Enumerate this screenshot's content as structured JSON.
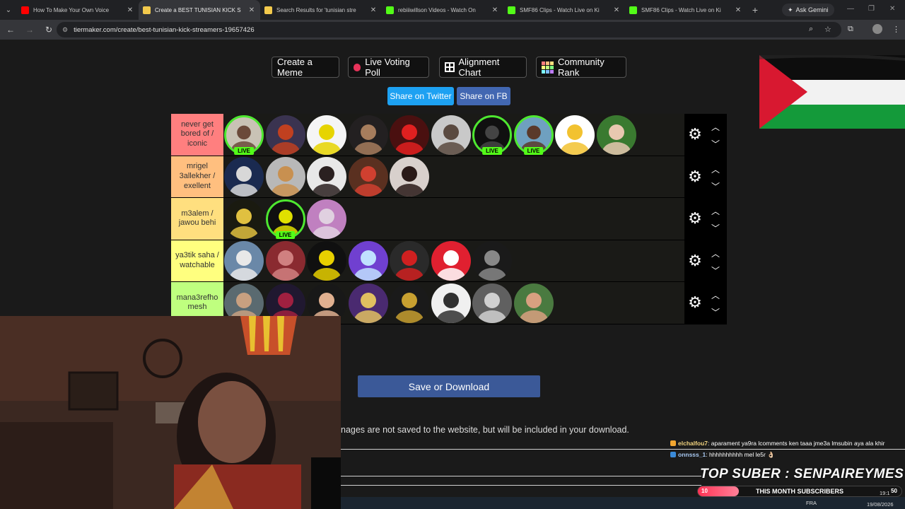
{
  "browser": {
    "tabs": [
      {
        "title": "How To Make Your Own Voice",
        "color": "#ff0000",
        "active": false
      },
      {
        "title": "Create a BEST TUNISIAN KICK S",
        "color": "#f2c94c",
        "active": true
      },
      {
        "title": "Search Results for 'tunisian stre",
        "color": "#f2c94c",
        "active": false
      },
      {
        "title": "rebiiiwillson Videos - Watch On",
        "color": "#53fc18",
        "active": false
      },
      {
        "title": "SMF86 Clips - Watch Live on Ki",
        "color": "#53fc18",
        "active": false
      },
      {
        "title": "SMF86 Clips - Watch Live on Ki",
        "color": "#53fc18",
        "active": false
      }
    ],
    "gemini_label": "Ask Gemini",
    "url": "tiermaker.com/create/best-tunisian-kick-streamers-19657426"
  },
  "top_buttons": {
    "create_meme": "Create a Meme",
    "live_poll": "Live Voting Poll",
    "alignment": "Alignment Chart",
    "community": "Community Rank"
  },
  "share": {
    "twitter": "Share on Twitter",
    "fb": "Share on FB"
  },
  "live_label": "LIVE",
  "tiers": [
    {
      "label": "never get bored of / iconic",
      "color": "#ff7f7f",
      "items": [
        {
          "bg": "#c9c2b5",
          "fg": "#6b4a3a",
          "live": true
        },
        {
          "bg": "#3a3350",
          "fg": "#c04020",
          "live": false
        },
        {
          "bg": "#f5f5f5",
          "fg": "#e6d400",
          "live": false
        },
        {
          "bg": "#232021",
          "fg": "#a67d5d",
          "live": false
        },
        {
          "bg": "#4a1010",
          "fg": "#e02020",
          "live": false
        },
        {
          "bg": "#c9c9c9",
          "fg": "#5a4a40",
          "live": false
        },
        {
          "bg": "#101010",
          "fg": "#444444",
          "live": true
        },
        {
          "bg": "#6fa0c0",
          "fg": "#5a3a2a",
          "live": true
        },
        {
          "bg": "#ffffff",
          "fg": "#f2c230",
          "live": false
        },
        {
          "bg": "#3a7a30",
          "fg": "#e8c8b0",
          "live": false
        }
      ]
    },
    {
      "label": "mrigel 3allekher / exellent",
      "color": "#ffbf7f",
      "items": [
        {
          "bg": "#1a2a50",
          "fg": "#d8d8d8",
          "live": false
        },
        {
          "bg": "#b8b8b8",
          "fg": "#c89050",
          "live": false
        },
        {
          "bg": "#e8e8e8",
          "fg": "#2a2020",
          "live": false
        },
        {
          "bg": "#5a3020",
          "fg": "#d04030",
          "live": false
        },
        {
          "bg": "#d8d0cc",
          "fg": "#2a1a18",
          "live": false
        }
      ]
    },
    {
      "label": "m3alem / jawou behi",
      "color": "#ffdf7f",
      "items": [
        {
          "bg": "#1a1a10",
          "fg": "#e0c040",
          "live": false
        },
        {
          "bg": "#101010",
          "fg": "#e0e000",
          "live": true
        },
        {
          "bg": "#c080c0",
          "fg": "#e0d0e0",
          "live": false
        }
      ]
    },
    {
      "label": "ya3tik saha / watchable",
      "color": "#ffff7f",
      "items": [
        {
          "bg": "#6a88a8",
          "fg": "#e8e8e8",
          "live": false
        },
        {
          "bg": "#8a2a30",
          "fg": "#d08080",
          "live": false
        },
        {
          "bg": "#101010",
          "fg": "#e8d000",
          "live": false
        },
        {
          "bg": "#7040d0",
          "fg": "#c0e0ff",
          "live": false
        },
        {
          "bg": "#2a2a2a",
          "fg": "#d02020",
          "live": false
        },
        {
          "bg": "#e02030",
          "fg": "#ffffff",
          "live": false
        },
        {
          "bg": "#1a1a1a",
          "fg": "#888888",
          "live": false
        }
      ]
    },
    {
      "label": "mana3refho mesh",
      "color": "#bfff7f",
      "items": [
        {
          "bg": "#5a6a70",
          "fg": "#c8a080",
          "live": false
        },
        {
          "bg": "#201830",
          "fg": "#a02040",
          "live": false
        },
        {
          "bg": "#181818",
          "fg": "#e0b090",
          "live": false
        },
        {
          "bg": "#4a2a70",
          "fg": "#e0c060",
          "live": false
        },
        {
          "bg": "#1a1a1a",
          "fg": "#c8a030",
          "live": false
        },
        {
          "bg": "#f0f0f0",
          "fg": "#303030",
          "live": false
        },
        {
          "bg": "#606060",
          "fg": "#d0d0d0",
          "live": false
        },
        {
          "bg": "#4a7a40",
          "fg": "#d8a080",
          "live": false
        }
      ]
    }
  ],
  "save_button": "Save or Download",
  "note": "nages are not saved to the website, but will be included in your download.",
  "overlay": {
    "chat": [
      {
        "user": "elchalfou7",
        "msg": ": aparament ya9ra lcomments ken taaa jme3a lmsubin aya ala khir",
        "color": "#f2a630"
      },
      {
        "user": "onnsss_1",
        "msg": ": hhhhhhhhhh mel le5r 👌🏻",
        "color": "#3a8ad8"
      }
    ],
    "top_suber": "TOP SUBER : SENPAIREYMES",
    "subs_start": "10",
    "subs_label": "THIS MONTH SUBSCRIBERS",
    "subs_goal": "50",
    "subs_progress": 0.2,
    "clock": "19:1",
    "date": "19/08/2026",
    "lang": "FRA"
  }
}
